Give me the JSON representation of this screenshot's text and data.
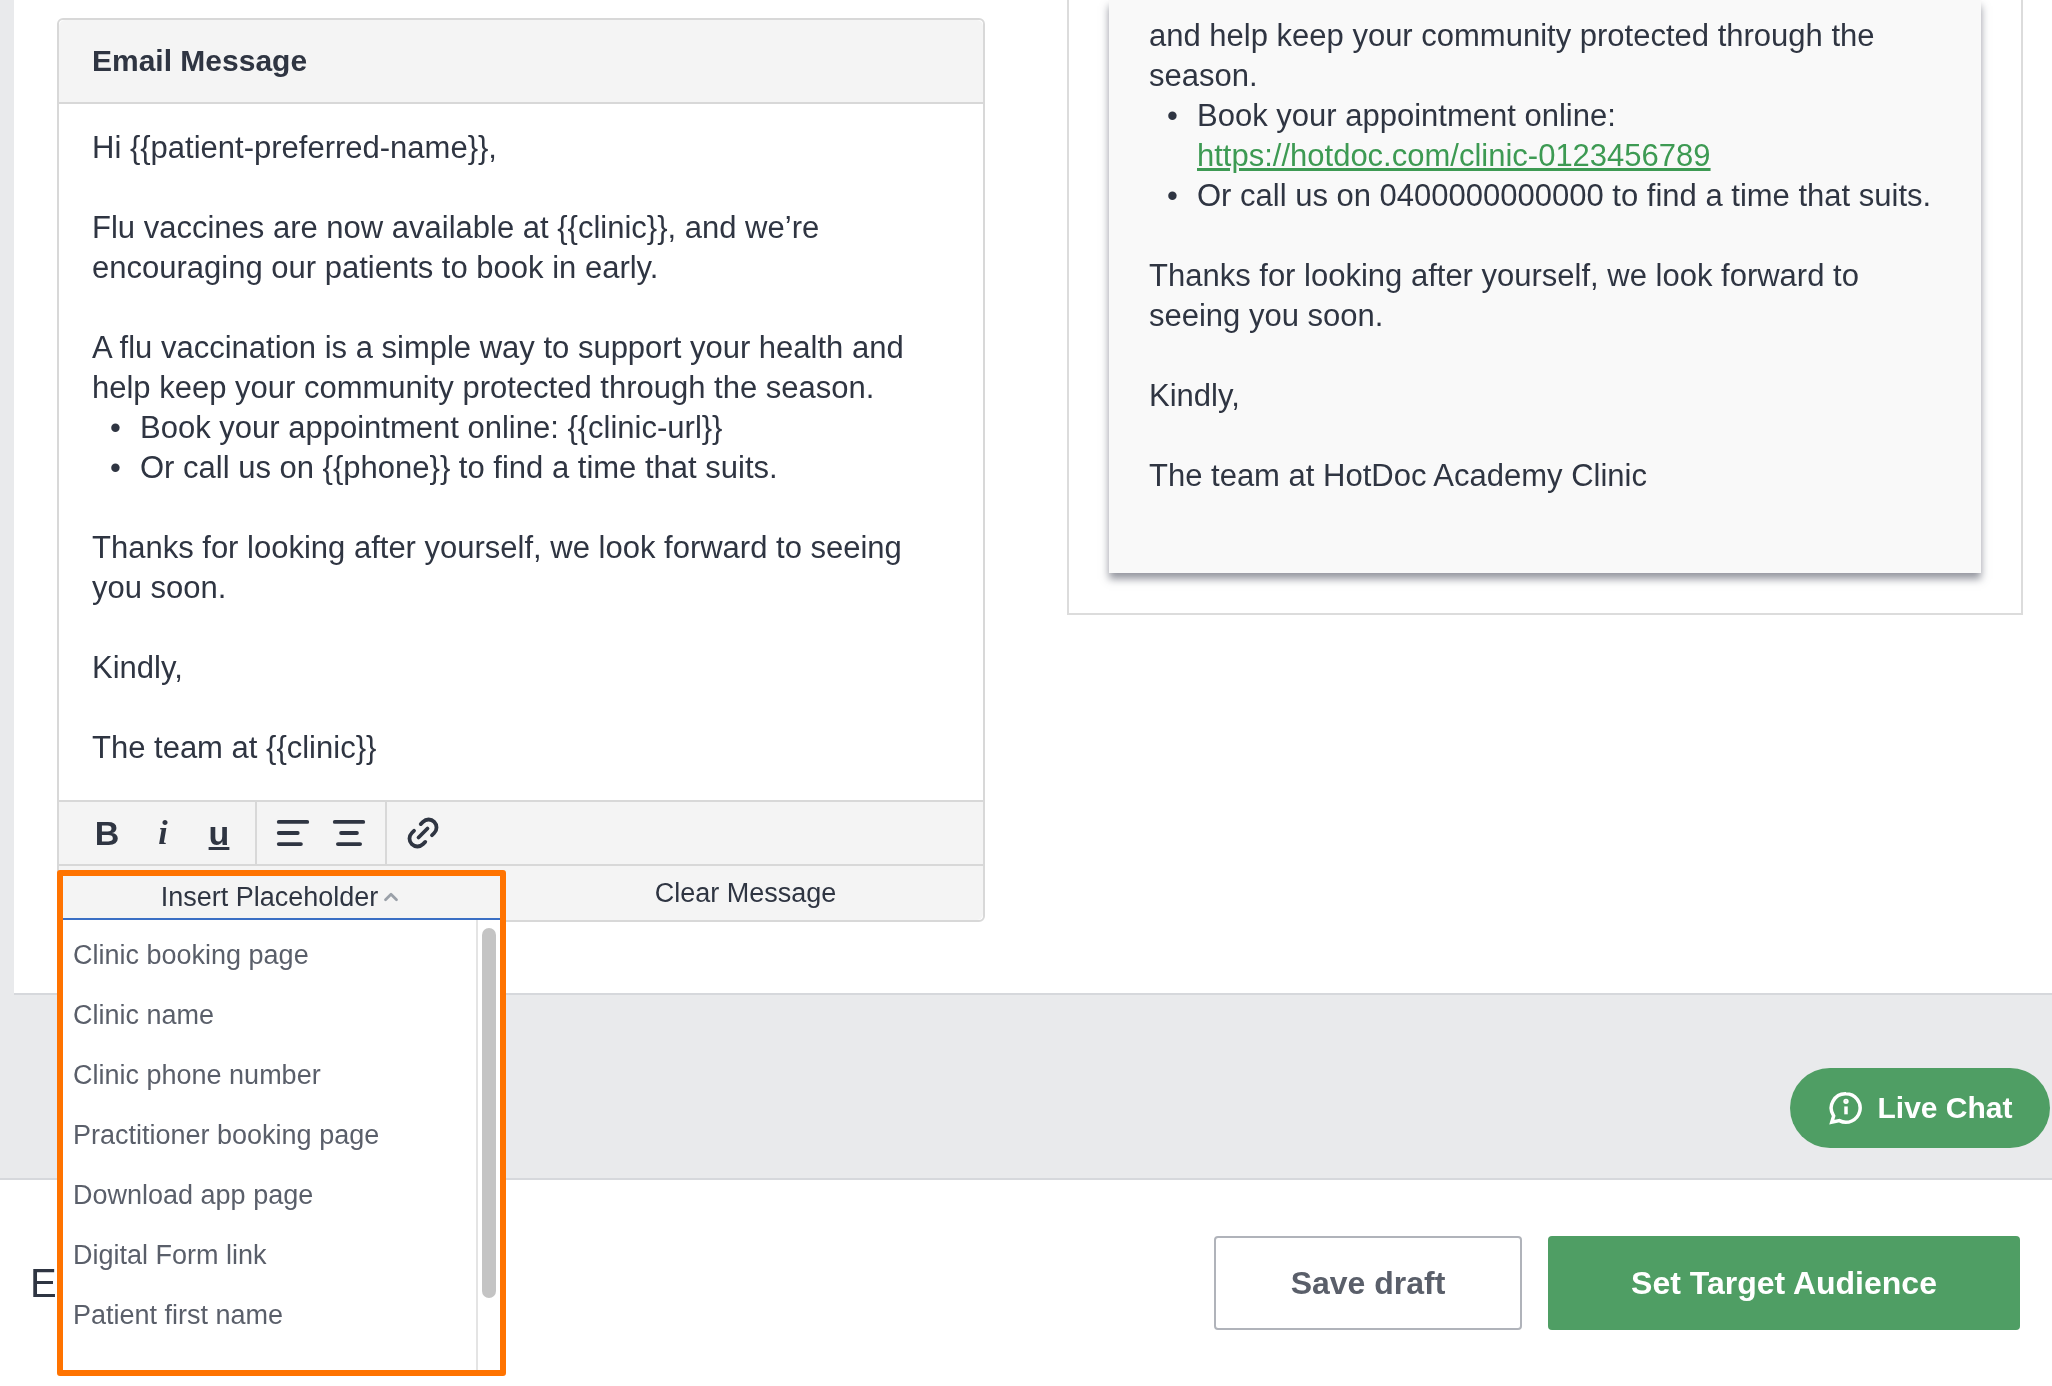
{
  "email_editor": {
    "title": "Email Message",
    "body": [
      {
        "kind": "paragraph",
        "text": "Hi {{patient-preferred-name}},"
      },
      {
        "kind": "paragraph",
        "text": "Flu vaccines are now available at {{clinic}}, and we’re encouraging our patients to book in early."
      },
      {
        "kind": "paragraph",
        "text": "A flu vaccination is a simple way to support your health and help keep your community protected through the season."
      },
      {
        "kind": "list",
        "marker": "•",
        "items": [
          {
            "text": "Book your appointment online: {{clinic-url}}"
          },
          {
            "text": "Or call us on {{phone}} to find a time that suits."
          }
        ]
      },
      {
        "kind": "paragraph",
        "text": "Thanks for looking after yourself, we look forward to seeing you soon."
      },
      {
        "kind": "paragraph",
        "text": "Kindly,"
      },
      {
        "kind": "paragraph",
        "text": "The team at {{clinic}}"
      }
    ],
    "toolbar": [
      {
        "kind": "bold",
        "label": "B"
      },
      {
        "kind": "italic",
        "label": "i"
      },
      {
        "kind": "underline",
        "label": "u"
      },
      {
        "kind": "align-left"
      },
      {
        "kind": "align-center"
      },
      {
        "kind": "link"
      }
    ],
    "insert_placeholder": {
      "label": "Insert Placeholder",
      "expanded": true,
      "options": [
        "Clinic booking page",
        "Clinic name",
        "Clinic phone number",
        "Practitioner booking page",
        "Download app page",
        "Digital Form link",
        "Patient first name"
      ]
    },
    "clear_button": "Clear Message"
  },
  "preview": {
    "body": [
      {
        "kind": "paragraph",
        "text": "and help keep your community protected through the season."
      },
      {
        "kind": "list",
        "marker": "•",
        "items": [
          {
            "text": "Book your appointment online:",
            "link": "https://hotdoc.com/clinic-0123456789"
          },
          {
            "text": "Or call us on 0400000000000 to find a time that suits."
          }
        ]
      },
      {
        "kind": "paragraph",
        "text": "Thanks for looking after yourself, we look forward to seeing you soon."
      },
      {
        "kind": "paragraph",
        "text": "Kindly,"
      },
      {
        "kind": "paragraph",
        "text": "The team at HotDoc Academy Clinic"
      }
    ]
  },
  "live_chat": {
    "label": "Live Chat"
  },
  "footer": {
    "heading": "E",
    "buttons": [
      {
        "kind": "secondary",
        "label": "Save draft"
      },
      {
        "kind": "primary",
        "label": "Set Target Audience"
      }
    ]
  }
}
